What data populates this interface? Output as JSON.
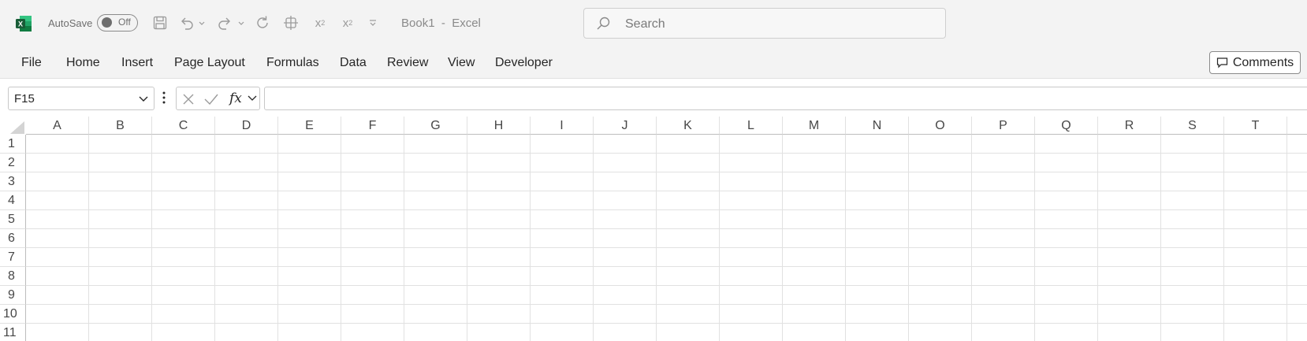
{
  "titlebar": {
    "app_icon": "excel-logo-icon",
    "autosave_label": "AutoSave",
    "autosave_state": "Off",
    "book_title": "Book1  -  Excel",
    "quick_access": [
      "save-icon",
      "undo-icon",
      "redo-icon",
      "refresh-icon",
      "touch-mode-icon",
      "subscript-icon",
      "superscript-icon",
      "customize-qat-icon"
    ],
    "subscript_label": "x",
    "subscript_sub": "2",
    "superscript_label": "x",
    "superscript_sup": "2"
  },
  "search": {
    "placeholder": "Search"
  },
  "menu": {
    "items": [
      "File",
      "Home",
      "Insert",
      "Page Layout",
      "Formulas",
      "Data",
      "Review",
      "View",
      "Developer"
    ],
    "comments_label": "Comments"
  },
  "formula_bar": {
    "name_box": "F15",
    "fx_label": "fx",
    "formula_value": ""
  },
  "sheet": {
    "columns": [
      "A",
      "B",
      "C",
      "D",
      "E",
      "F",
      "G",
      "H",
      "I",
      "J",
      "K",
      "L",
      "M",
      "N",
      "O",
      "P",
      "Q",
      "R",
      "S",
      "T"
    ],
    "rows": [
      "1",
      "2",
      "3",
      "4",
      "5",
      "6",
      "7",
      "8",
      "9",
      "10",
      "11"
    ]
  },
  "colors": {
    "excel_green": "#107c41",
    "chrome_bg": "#f3f3f3",
    "gridline": "#e1e1e1"
  }
}
